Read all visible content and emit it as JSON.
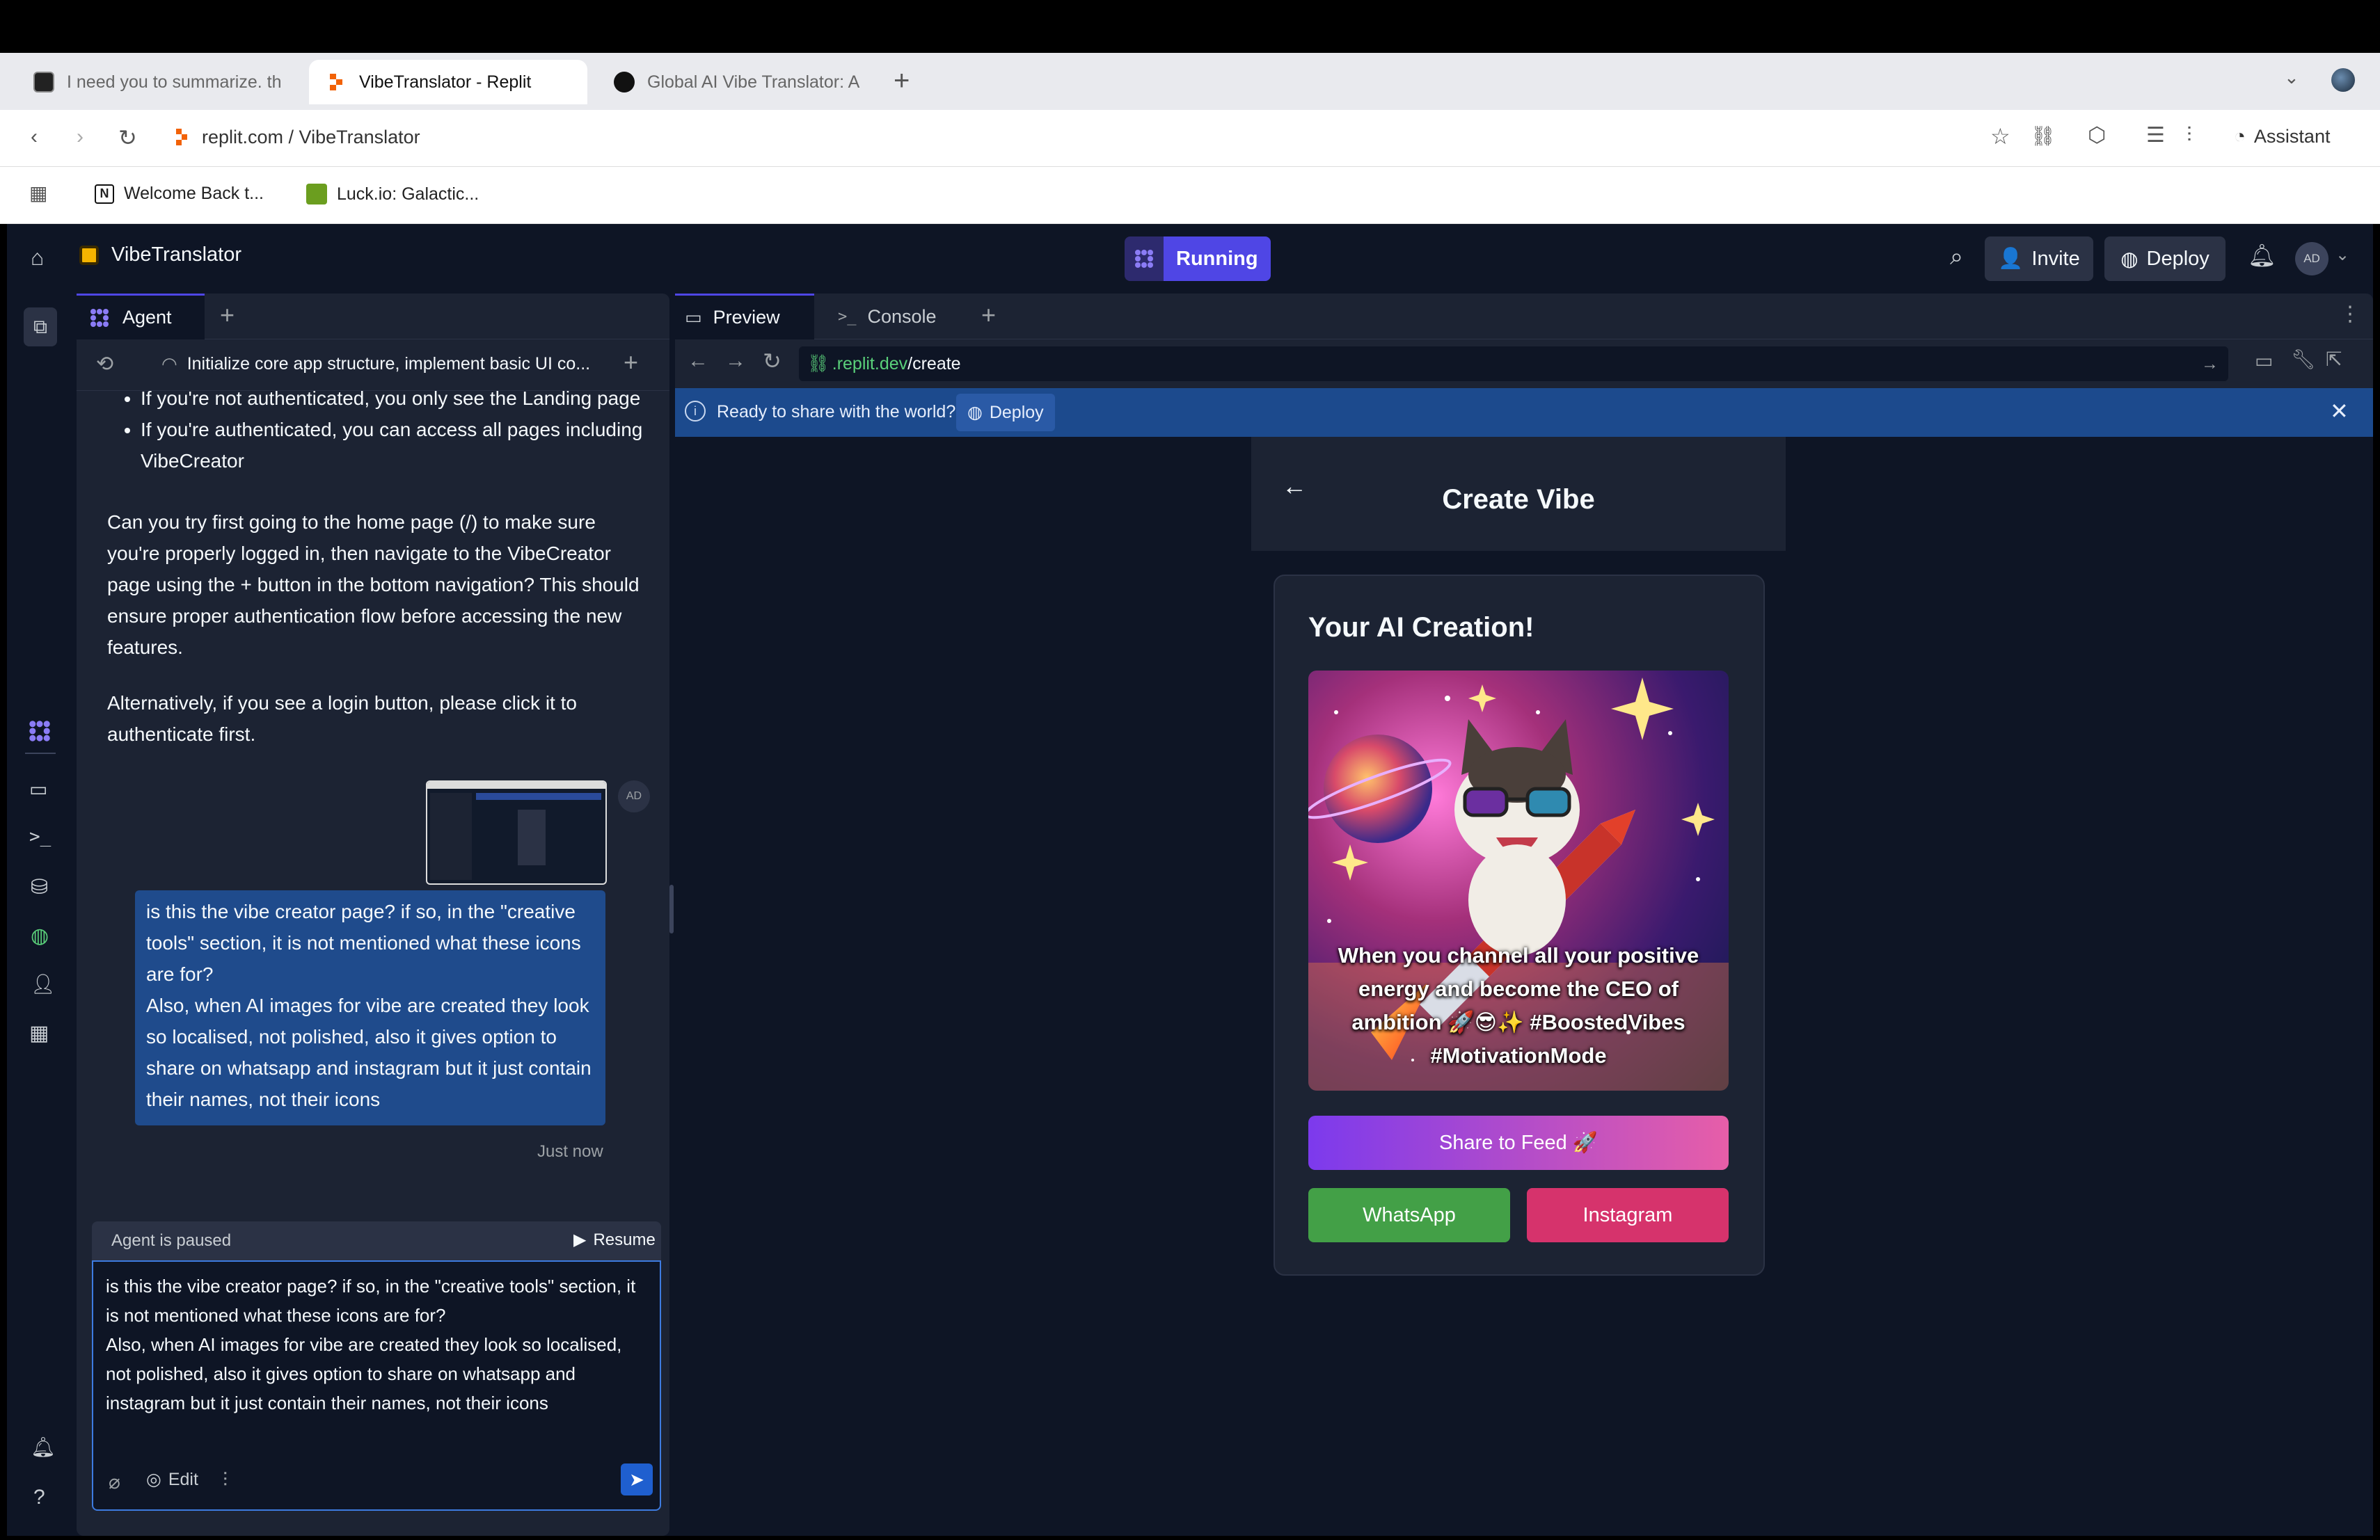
{
  "browser": {
    "tabs": [
      {
        "title": "I need you to summarize. th"
      },
      {
        "title": "VibeTranslator - Replit"
      },
      {
        "title": "Global AI Vibe Translator: A"
      }
    ],
    "url_domain": "replit.com",
    "url_sep": " / ",
    "url_path": "VibeTranslator",
    "assistant_label": "Assistant",
    "bookmarks": [
      {
        "label": "Welcome Back t..."
      },
      {
        "label": "Luck.io: Galactic..."
      }
    ]
  },
  "app": {
    "project_name": "VibeTranslator",
    "status": "Running",
    "invite_label": "Invite",
    "deploy_label": "Deploy",
    "avatar": "AD"
  },
  "agent": {
    "tab_label": "Agent",
    "thread_title": "Initialize core app structure, implement basic UI co...",
    "bullet1": "If you're not authenticated, you only see the Landing page",
    "bullet2": "If you're authenticated, you can access all pages including VibeCreator",
    "para1": "Can you try first going to the home page (/) to make sure you're properly logged in, then navigate to the VibeCreator page using the + button in the bottom navigation? This should ensure proper authentication flow before accessing the new features.",
    "para2": "Alternatively, if you see a login button, please click it to authenticate first.",
    "user_avatar": "AD",
    "user_message": "is this the vibe creator page? if so, in the \"creative tools\" section, it is not mentioned what these icons are for?\nAlso, when AI images for vibe are created they look so localised, not polished, also it gives option to share on whatsapp and instagram but it just contain their names, not their icons",
    "timestamp": "Just now",
    "paused_label": "Agent is paused",
    "resume_label": "Resume",
    "input_text": "is this the vibe creator page? if so, in the \"creative tools\" section, it is not mentioned what these icons are for?\nAlso, when AI images for vibe are created they look so localised, not polished, also it gives option to share on whatsapp and instagram but it just contain their names, not their icons",
    "edit_label": "Edit"
  },
  "preview": {
    "tab_preview": "Preview",
    "tab_console": "Console",
    "url_host": ".replit.dev",
    "url_path": "/create",
    "banner_text": "Ready to share with the world?",
    "banner_button": "Deploy",
    "page_title": "Create Vibe",
    "card_title": "Your AI Creation!",
    "caption": "When you channel all your positive energy and become the CEO of ambition 🚀😎✨ #BoostedVibes #MotivationMode",
    "share_feed": "Share to Feed 🚀",
    "whatsapp": "WhatsApp",
    "instagram": "Instagram"
  },
  "colors": {
    "accent": "#4f46e5",
    "banner": "#1c4a8d",
    "whatsapp": "#43a047",
    "instagram": "#d6336c",
    "message_bubble": "#1f4b8c"
  }
}
